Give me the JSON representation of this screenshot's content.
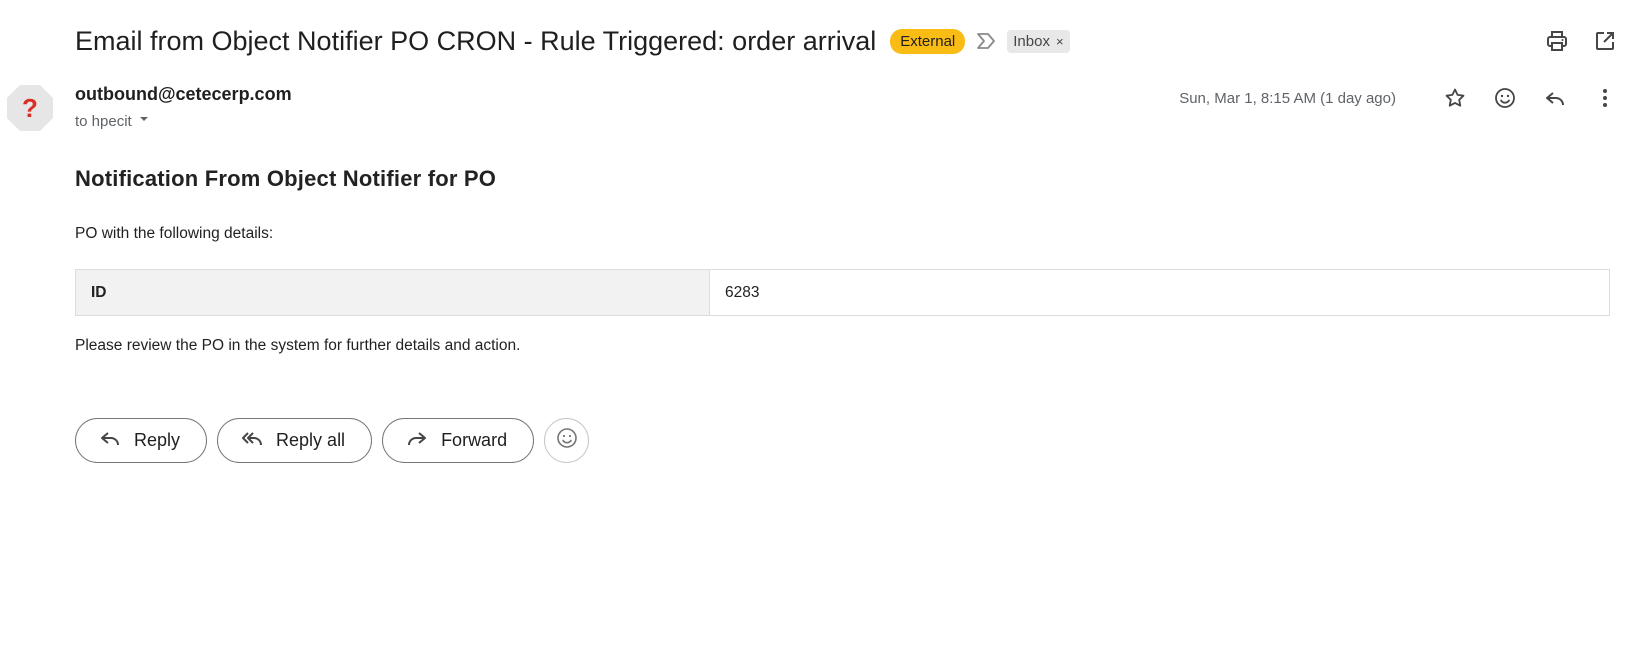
{
  "email": {
    "subject": "Email from Object Notifier PO CRON - Rule Triggered: order arrival",
    "labels": {
      "external": "External",
      "inbox": "Inbox",
      "inbox_remove": "×"
    },
    "sender": {
      "email": "outbound@cetecerp.com",
      "recipient_line": "to hpecit",
      "avatar_glyph": "?"
    },
    "timestamp": "Sun, Mar 1, 8:15 AM (1 day ago)",
    "body": {
      "heading": "Notification From Object Notifier for PO",
      "intro": "PO with the following details:",
      "table": [
        {
          "key": "ID",
          "value": "6283"
        }
      ],
      "outro": "Please review the PO in the system for further details and action."
    },
    "actions": {
      "reply": "Reply",
      "reply_all": "Reply all",
      "forward": "Forward"
    }
  },
  "icons": {
    "top": [
      "print-icon",
      "open-in-new-window-icon"
    ],
    "meta": [
      "star-icon",
      "emoji-icon",
      "reply-icon",
      "more-vert-icon"
    ]
  },
  "colors": {
    "external_badge": "#f9bc15",
    "inbox_label_bg": "#e8e8e8",
    "avatar_glyph": "#d93025",
    "table_key_bg": "#f2f2f2"
  }
}
